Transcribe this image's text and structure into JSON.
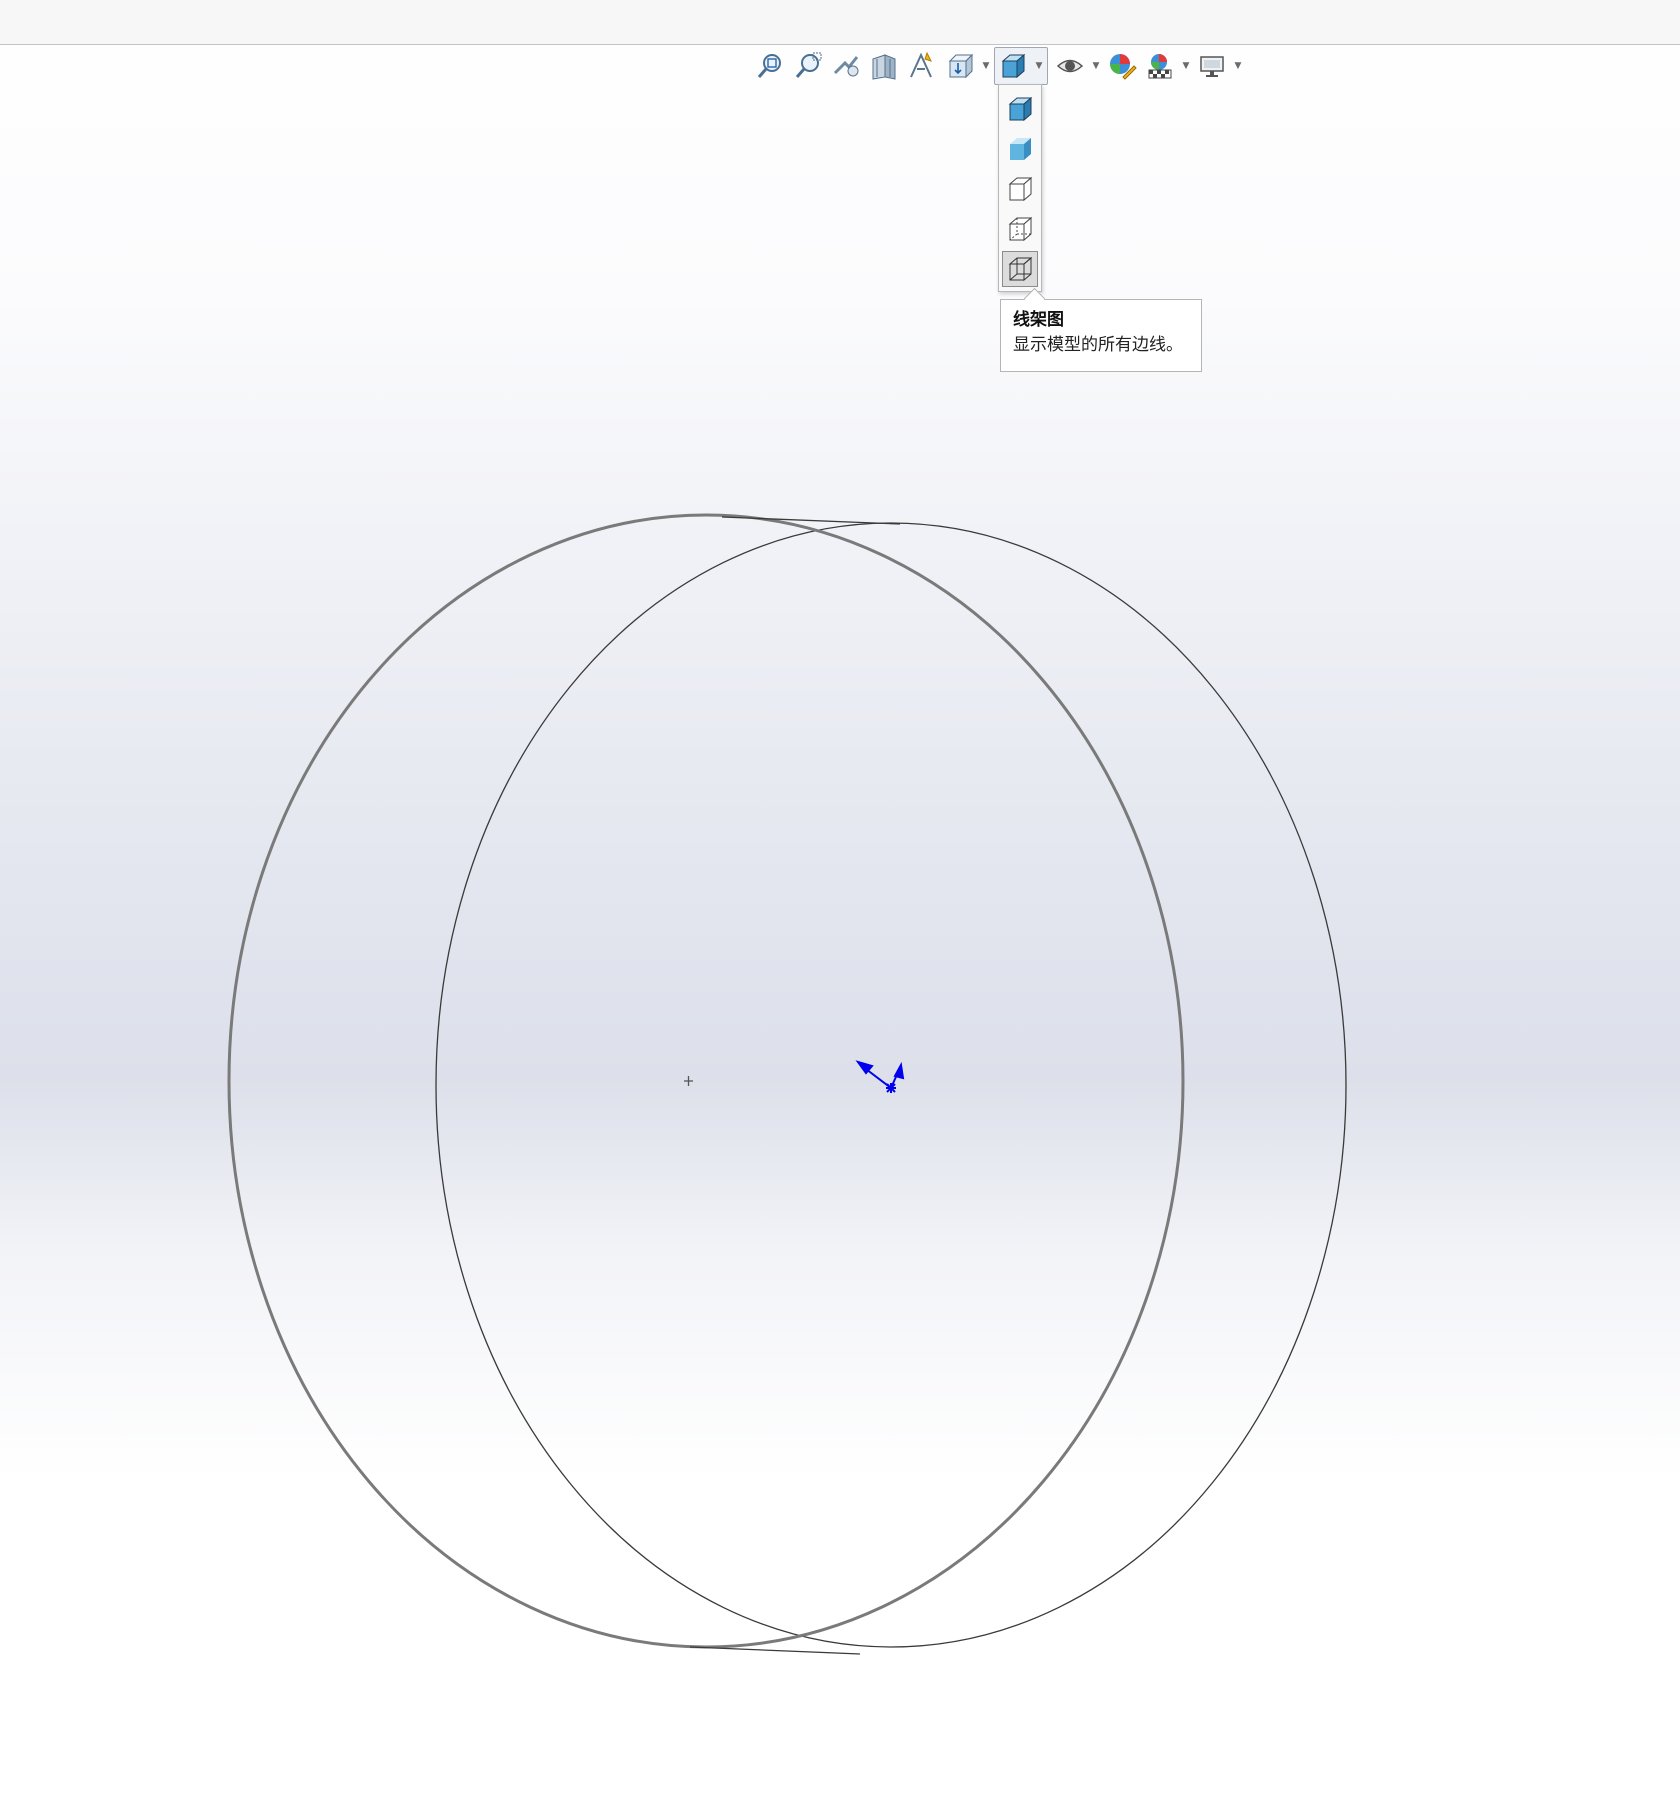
{
  "toolbar": {
    "icons": [
      "zoom-to-fit-icon",
      "zoom-to-area-icon",
      "previous-view-icon",
      "section-view-icon",
      "dynamic-annotation-icon",
      "view-orientation-icon",
      "display-style-icon",
      "hide-show-items-icon",
      "edit-appearance-icon",
      "apply-scene-icon",
      "view-settings-icon"
    ]
  },
  "display_style_flyout": {
    "items": [
      "shaded-with-edges-icon",
      "shaded-icon",
      "hidden-lines-removed-icon",
      "hidden-lines-visible-icon",
      "wireframe-icon"
    ],
    "selected": "wireframe-icon"
  },
  "tooltip": {
    "title": "线架图",
    "description": "显示模型的所有边线。"
  },
  "colors": {
    "accent": "#1a5fa8",
    "triad": "#0000ee",
    "model_edge": "#7a7a7a"
  }
}
